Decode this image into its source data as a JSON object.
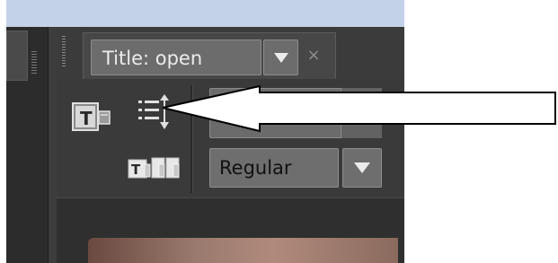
{
  "panel": {
    "title_button_label": "Title: open",
    "title_dropdown_icon": "triangle-down-icon",
    "close_glyph": "×"
  },
  "toolbar": {
    "title_tool_icon": "text-title-icon",
    "list_tool_icon": "line-spacing-icon",
    "preset_tool_icon": "text-presets-icon",
    "font_family_value": "",
    "font_style_value": "Regular"
  },
  "annotation": {
    "arrow_icon": "arrow-pointer-icon"
  },
  "colors": {
    "panel_bg": "#353535",
    "control_bg": "#6c6c6c",
    "top_strip": "#c3d2e8",
    "arrow_fill": "#ffffff",
    "arrow_stroke": "#000000"
  }
}
